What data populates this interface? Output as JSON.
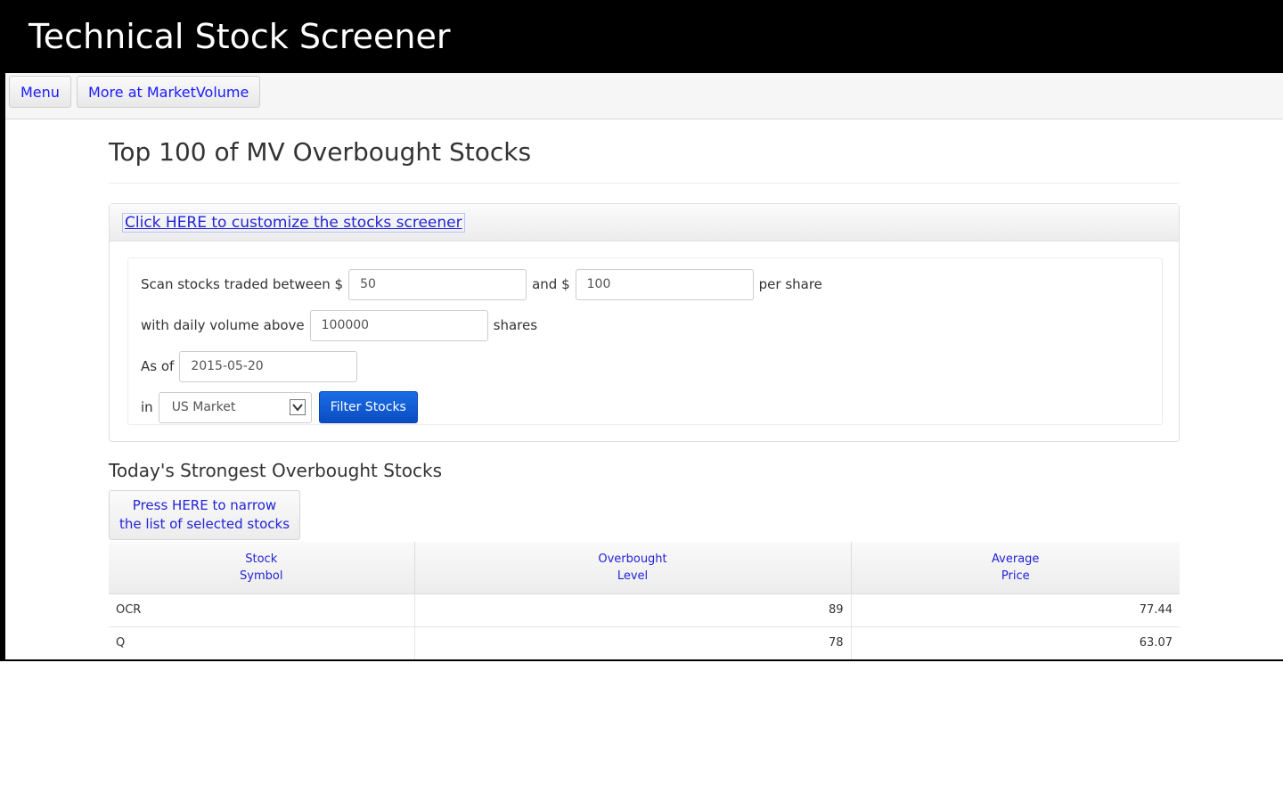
{
  "app": {
    "title": "Technical Stock Screener"
  },
  "menu": {
    "menu_label": "Menu",
    "more_label": "More at MarketVolume"
  },
  "page": {
    "title": "Top 100 of MV Overbought Stocks"
  },
  "customize": {
    "link_label": "Click HERE to customize the stocks screener"
  },
  "form": {
    "scan_label": "Scan stocks traded between $",
    "min_price": "50",
    "and_label": "and $",
    "max_price": "100",
    "per_share_label": "per share",
    "volume_label": "with daily volume above",
    "volume": "100000",
    "shares_label": "shares",
    "asof_label": "As of",
    "date": "2015-05-20",
    "in_label": "in",
    "market": "US Market",
    "filter_label": "Filter Stocks"
  },
  "results": {
    "title": "Today's Strongest Overbought Stocks",
    "narrow_line1": "Press HERE to narrow",
    "narrow_line2": "the list of selected stocks",
    "headers": [
      {
        "line1": "Stock",
        "line2": "Symbol"
      },
      {
        "line1": "Overbought",
        "line2": "Level"
      },
      {
        "line1": "Average",
        "line2": "Price"
      }
    ],
    "rows": [
      {
        "symbol": "OCR",
        "level": "89",
        "price": "77.44"
      },
      {
        "symbol": "Q",
        "level": "78",
        "price": "63.07"
      }
    ]
  }
}
